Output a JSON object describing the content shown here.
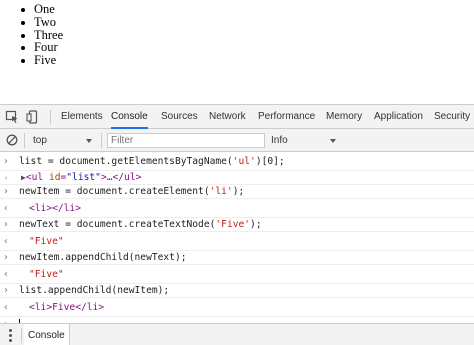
{
  "page": {
    "list_items": [
      "One",
      "Two",
      "Three",
      "Four",
      "Five"
    ]
  },
  "devtools": {
    "tabs": [
      "Elements",
      "Console",
      "Sources",
      "Network",
      "Performance",
      "Memory",
      "Application",
      "Security"
    ],
    "active_tab": "Console",
    "toolbar": {
      "context": "top",
      "filter_placeholder": "Filter",
      "level": "Info"
    },
    "console_lines": [
      {
        "kind": "input",
        "text": "list = document.getElementsByTagName('ul')[0];"
      },
      {
        "kind": "output",
        "text": "<ul id=\"list\">…</ul>"
      },
      {
        "kind": "input",
        "text": "newItem = document.createElement('li');"
      },
      {
        "kind": "output",
        "text": "<li></li>"
      },
      {
        "kind": "input",
        "text": "newText = document.createTextNode('Five');"
      },
      {
        "kind": "output",
        "text": "\"Five\""
      },
      {
        "kind": "input",
        "text": "newItem.appendChild(newText);"
      },
      {
        "kind": "output",
        "text": "\"Five\""
      },
      {
        "kind": "input",
        "text": "list.appendChild(newItem);"
      },
      {
        "kind": "output",
        "text": "<li>Five</li>"
      }
    ],
    "drawer": {
      "tab": "Console"
    }
  },
  "colors": {
    "active_tab_underline": "#1a73e8",
    "string": "#c41a16",
    "tag": "#881280",
    "attribute_name": "#994500",
    "attribute_value": "#1a1aa6"
  }
}
